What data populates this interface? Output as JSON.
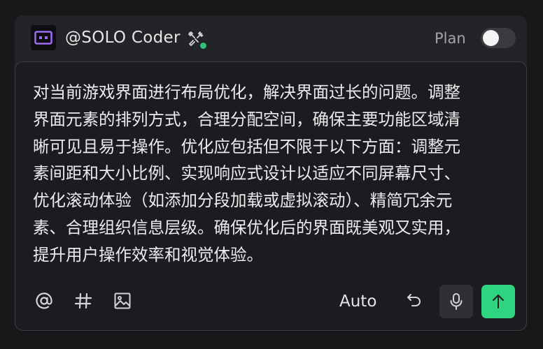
{
  "header": {
    "agent_name": "@SOLO Coder",
    "agent_icon": "robot-face-icon",
    "tools_icon": "tools-icon",
    "status_color": "#2ec27e",
    "plan_label": "Plan",
    "plan_enabled": false
  },
  "composer": {
    "prompt_text": "对当前游戏界面进行布局优化，解决界面过长的问题。调整\n界面元素的排列方式，合理分配空间，确保主要功能区域清\n晰可见且易于操作。优化应包括但不限于以下方面：调整元\n素间距和大小比例、实现响应式设计以适应不同屏幕尺寸、\n优化滚动体验（如添加分段加载或虚拟滚动）、精简冗余元\n素、合理组织信息层级。确保优化后的界面既美观又实用，\n提升用户操作效率和视觉体验。"
  },
  "toolbar": {
    "mention_icon": "at-sign-icon",
    "hash_icon": "hash-icon",
    "image_icon": "image-icon",
    "mode_label": "Auto",
    "undo_icon": "undo-icon",
    "mic_icon": "microphone-icon",
    "send_icon": "arrow-up-icon",
    "send_color": "#2ed47f"
  }
}
